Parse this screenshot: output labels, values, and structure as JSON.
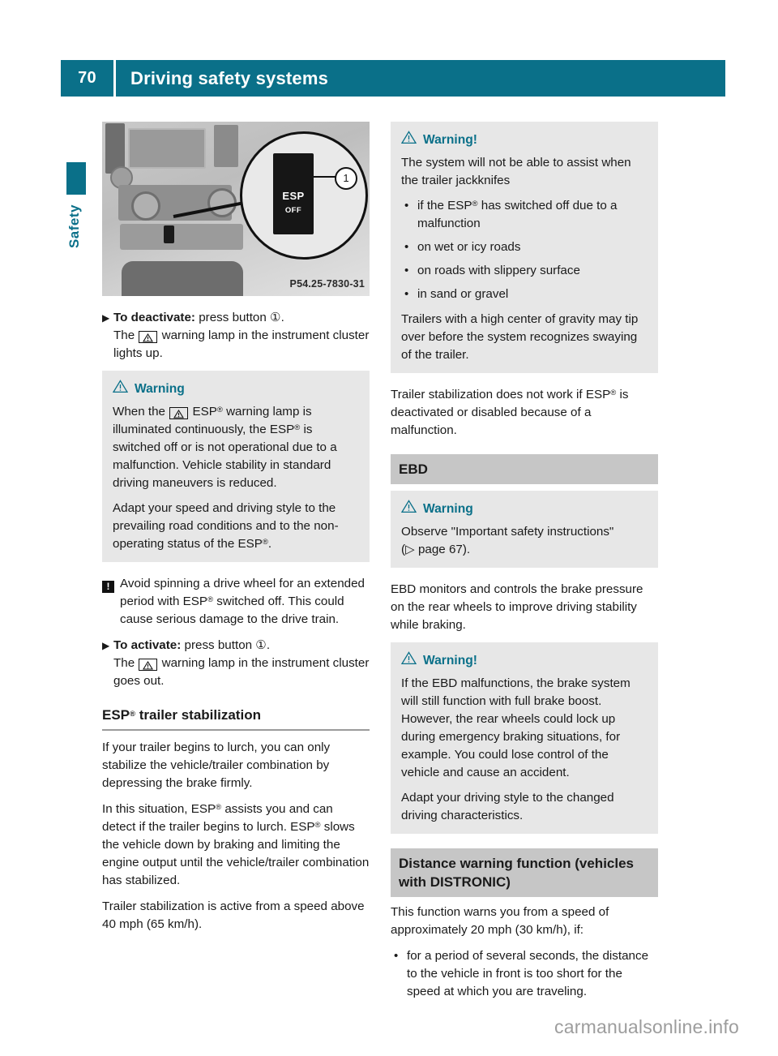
{
  "header": {
    "page_number": "70",
    "title": "Driving safety systems",
    "accent_color": "#0a7089"
  },
  "sidebar": {
    "tab_label": "Safety"
  },
  "figure": {
    "esp_label": "ESP",
    "off_label": "OFF",
    "callout_number": "1",
    "figure_code": "P54.25-7830-31"
  },
  "left_column": {
    "step_deactivate": {
      "bold_lead": "To deactivate:",
      "rest": " press button ①.",
      "line2_pre": "The ",
      "line2_post": " warning lamp in the instrument cluster lights up."
    },
    "warning_esp": {
      "title": "Warning",
      "p1_pre": "When the ",
      "p1_mid": " ESP",
      "p1_post": " warning lamp is illuminated continuously, the ESP",
      "p1_tail": " is switched off or is not operational due to a malfunction. Vehicle stability in standard driving maneuvers is reduced.",
      "p2_pre": "Adapt your speed and driving style to the prevailing road conditions and to the non-operating status of the ESP",
      "p2_tail": "."
    },
    "notice_spinning": {
      "icon_char": "!",
      "text_pre": "Avoid spinning a drive wheel for an extended period with ESP",
      "text_post": " switched off. This could cause serious damage to the drive train."
    },
    "step_activate": {
      "bold_lead": "To activate:",
      "rest": " press button ①.",
      "line2_pre": "The ",
      "line2_post": " warning lamp in the instrument cluster goes out."
    },
    "heading_trailer": {
      "pre": "ESP",
      "post": " trailer stabilization"
    },
    "p_trailer_1": "If your trailer begins to lurch, you can only stabilize the vehicle/trailer combination by depressing the brake firmly.",
    "p_trailer_2_pre": "In this situation, ESP",
    "p_trailer_2_mid": " assists you and can detect if the trailer begins to lurch. ESP",
    "p_trailer_2_post": " slows the vehicle down by braking and limiting the engine output until the vehicle/trailer combination has stabilized.",
    "p_trailer_3": "Trailer stabilization is active from a speed above 40 mph (65 km/h)."
  },
  "right_column": {
    "warning_jackknife": {
      "title": "Warning!",
      "intro": "The system will not be able to assist when the trailer jackknifes",
      "bullets": [
        {
          "pre": "if the ESP",
          "post": " has switched off due to a malfunction"
        },
        {
          "pre": "on wet or icy roads",
          "post": ""
        },
        {
          "pre": "on roads with slippery surface",
          "post": ""
        },
        {
          "pre": "in sand or gravel",
          "post": ""
        }
      ],
      "outro": "Trailers with a high center of gravity may tip over before the system recognizes swaying of the trailer."
    },
    "p_trailer_esp_pre": "Trailer stabilization does not work if ESP",
    "p_trailer_esp_post": " is deactivated or disabled because of a malfunction.",
    "heading_ebd": "EBD",
    "warning_ebd_observe": {
      "title": "Warning",
      "text": "Observe \"Important safety instructions\"",
      "ref_pre": "(",
      "ref_arrow": "▷",
      "ref_text": " page 67)."
    },
    "p_ebd": "EBD monitors and controls the brake pressure on the rear wheels to improve driving stability while braking.",
    "warning_ebd_malfunction": {
      "title": "Warning!",
      "p1": "If the EBD malfunctions, the brake system will still function with full brake boost. However, the rear wheels could lock up during emergency braking situations, for example. You could lose control of the vehicle and cause an accident.",
      "p2": "Adapt your driving style to the changed driving characteristics."
    },
    "heading_distance": "Distance warning function (vehicles with DISTRONIC)",
    "p_distance": "This function warns you from a speed of approximately 20 mph (30 km/h), if:",
    "distance_bullets": [
      "for a period of several seconds, the distance to the vehicle in front is too short for the speed at which you are traveling."
    ]
  },
  "footer": {
    "watermark": "carmanualsonline.info"
  }
}
